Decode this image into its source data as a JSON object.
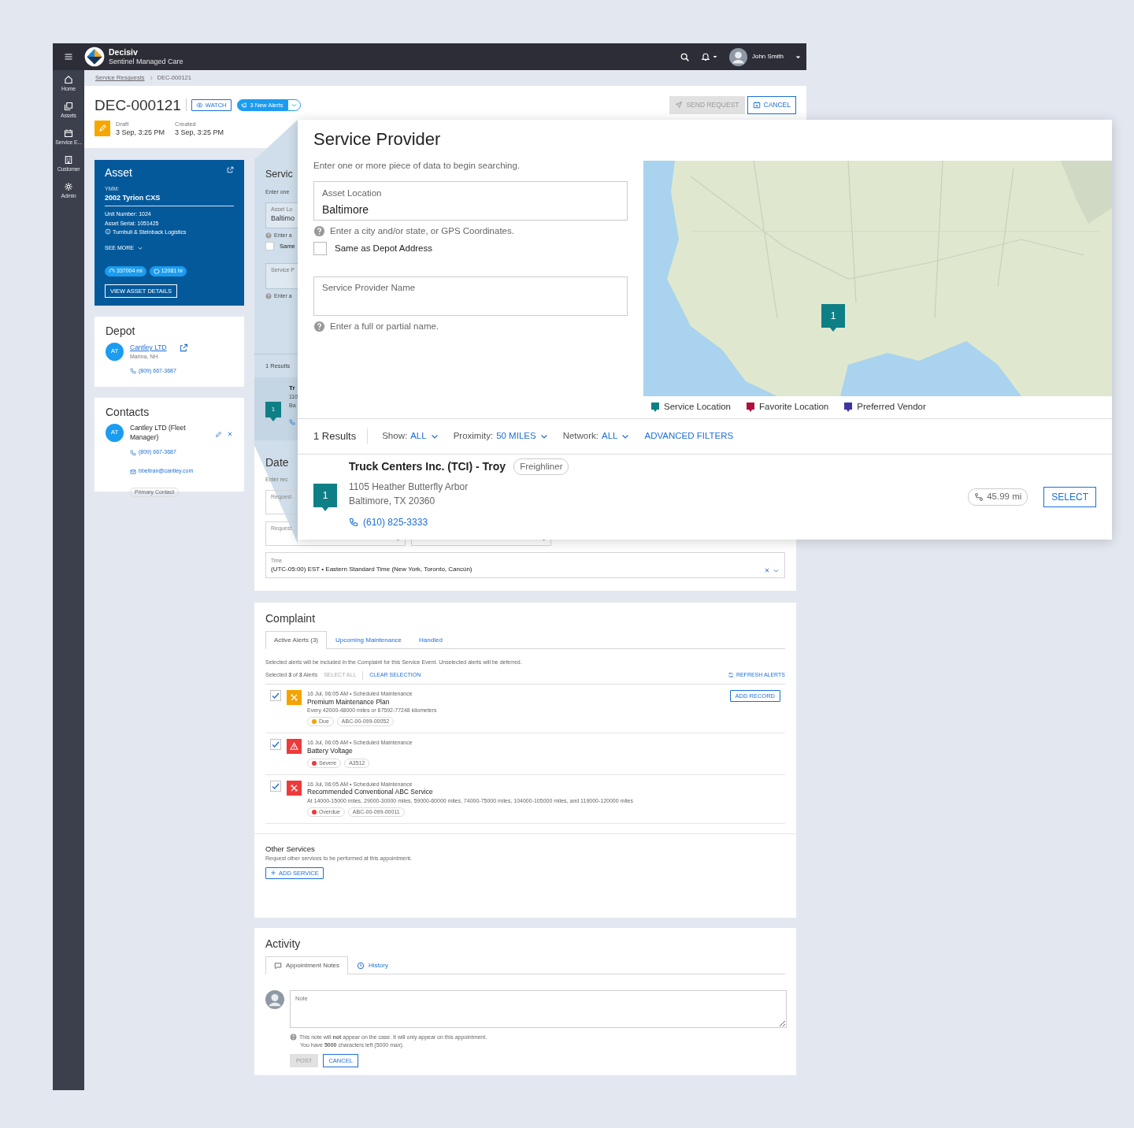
{
  "topbar": {
    "brand_name": "Decisiv",
    "brand_subtitle": "Sentinel Managed Care",
    "user_name": "John Smith"
  },
  "sidebar": {
    "items": [
      {
        "label": "Home"
      },
      {
        "label": "Assets"
      },
      {
        "label": "Service E..."
      },
      {
        "label": "Customer"
      },
      {
        "label": "Admin"
      }
    ]
  },
  "breadcrumb": [
    "Service Resquests",
    "DEC-000121"
  ],
  "header": {
    "title": "DEC-000121",
    "watch": "WATCH",
    "alerts": "3 New Alerts",
    "status_label": "Draft",
    "status_date": "3 Sep, 3:25 PM",
    "created_label": "Created",
    "created_date": "3 Sep, 3:25 PM",
    "send_request": {
      "label": "SEND REQUEST",
      "disabled": true
    },
    "cancel": "CANCEL"
  },
  "asset": {
    "title": "Asset",
    "ymm_label": "YMM:",
    "ymm": "2002 Tyrion CXS",
    "unit_number": "Unit Number: 1024",
    "serial": "Asset Serial: 1051425",
    "owner": "Turnbull & Steinback Logistics",
    "see_more": "SEE MORE",
    "mileage": "337004 mi",
    "hours": "12081 hr",
    "details_button": "VIEW ASSET DETAILS"
  },
  "depot": {
    "title": "Depot",
    "avatar": "AT",
    "name": "Cantley LTD",
    "location": "Marina, NH",
    "phone": "(809) 667-3687"
  },
  "contacts": {
    "title": "Contacts",
    "items": [
      {
        "avatar": "AT",
        "name": "Cantley LTD (Fleet Manager)",
        "phone": "(809) 667-3687",
        "email": "bbeltran@cantley.com",
        "tag": "Primary Contact"
      }
    ]
  },
  "service_card": {
    "title": "Servic",
    "hint": "Enter one",
    "location_label": "Asset Lo",
    "location_value": "Baltimo",
    "location_help": "Enter a",
    "same_label": "Same",
    "name_label": "Service P",
    "name_help": "Enter a",
    "results": "1 Results",
    "marker": "1",
    "result_name": "Tr",
    "result_line1": "110",
    "result_line2": "Ba"
  },
  "date": {
    "title": "Date",
    "hint": "Enter rec",
    "fields": [
      {
        "label": "Request"
      },
      {
        "label": "Request"
      }
    ],
    "time_label": "Time",
    "time_value": "(UTC-05:00) EST • Eastern Standard Time (New York, Toronto, Cancún)"
  },
  "complaint": {
    "title": "Complaint",
    "tabs": [
      {
        "label": "Active Alerts (3)",
        "selected": true
      },
      {
        "label": "Upcoming Maintenance",
        "selected": false
      },
      {
        "label": "Handled",
        "selected": false
      }
    ],
    "note": "Selected alerts will be included in the Complaint for this Service Event. Unselected alerts will be deferred.",
    "selection": "Selected **3** of **3** Alerts",
    "select_all": {
      "label": "SELECT ALL",
      "disabled": true
    },
    "clear_selection": "CLEAR SELECTION",
    "refresh": "REFRESH ALERTS",
    "alerts": [
      {
        "checked": true,
        "kind": "maintenance",
        "meta": "16 Jul, 06:05 AM • Scheduled Maintenance",
        "title": "Premium Maintenance Plan",
        "description": "Every 42000-48000 miles or 67592-77248 kilometers",
        "status": "Due",
        "color": "#f5a300",
        "code": "ABC-00-099-00052",
        "action": "ADD RECORD"
      },
      {
        "checked": true,
        "kind": "fault",
        "meta": "16 Jul, 06:05 AM • Scheduled Maintenance",
        "title": "Battery Voltage",
        "status": "Severe",
        "color": "#ee3a3a",
        "code": "A3512"
      },
      {
        "checked": true,
        "kind": "maintenance",
        "meta": "16 Jul, 06:05 AM • Scheduled Maintenance",
        "title": "Recommended Conventional ABC Service",
        "description": "At 14000-15000 miles, 29000-30000 miles, 59000-60000 miles, 74000-75000 miles, 104000-105000 miles, and 119000-120000 miles",
        "status": "Overdue",
        "color": "#ee3a3a",
        "code": "ABC-00-099-00011"
      }
    ]
  },
  "other_services": {
    "title": "Other Services",
    "description": "Request other services to be performed at this appointment.",
    "button": "ADD SERVICE"
  },
  "activity": {
    "title": "Activity",
    "tabs": [
      {
        "label": "Appointment Notes",
        "selected": true
      },
      {
        "label": "History",
        "selected": false
      }
    ],
    "note_placeholder": "Note",
    "help": "This note will **not** appear on the case. It will only appear on this appointment.",
    "chars": "You have **5000** characters left (5000 max).",
    "post": {
      "label": "POST",
      "disabled": true
    },
    "cancel": "CANCEL"
  },
  "service_provider": {
    "title": "Service Provider",
    "hint": "Enter one or more piece of data to begin searching.",
    "location_label": "Asset Location",
    "location_value": "Baltimore",
    "location_help": "Enter a city and/or state, or GPS Coordinates.",
    "same_as_depot": {
      "label": "Same as Depot Address",
      "checked": false
    },
    "name_placeholder": "Service Provider Name",
    "name_help": "Enter a full or partial name.",
    "map": {
      "markers": [
        {
          "label": "1"
        }
      ]
    },
    "legend": [
      {
        "label": "Service Location",
        "color": "#0f7f86"
      },
      {
        "label": "Favorite Location",
        "color": "#b0103a"
      },
      {
        "label": "Preferred Vendor",
        "color": "#3f35a0"
      }
    ],
    "results_count": "1 Results",
    "filters": [
      {
        "label": "Show:",
        "value": "ALL"
      },
      {
        "label": "Proximity:",
        "value": "50 MILES"
      },
      {
        "label": "Network:",
        "value": "ALL"
      }
    ],
    "advanced": "ADVANCED FILTERS",
    "results": [
      {
        "marker": "1",
        "name": "Truck Centers Inc. (TCI) - Troy",
        "tag": "Freighliner",
        "address1": "1105 Heather Butterfly Arbor",
        "address2": "Baltimore, TX 20360",
        "phone": "(610) 825-3333",
        "distance": "45.99 mi",
        "action": "SELECT"
      }
    ]
  }
}
